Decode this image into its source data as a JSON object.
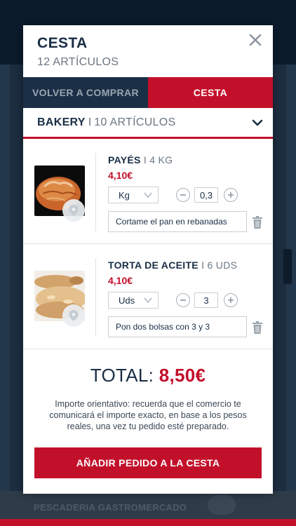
{
  "background": {
    "footer_text": "PESCADERIA GASTROMERCADO"
  },
  "cart": {
    "title": "CESTA",
    "subtitle": "12 ARTÍCULOS",
    "tabs": [
      {
        "label": "VOLVER A COMPRAR",
        "active": false
      },
      {
        "label": "CESTA",
        "active": true
      }
    ],
    "section": {
      "name": "BAKERY",
      "separator": "I",
      "count": "10 ARTÍCULOS"
    },
    "items": [
      {
        "name": "PAYÉS",
        "quantity_label": "I 4 KG",
        "price": "4,10€",
        "unit": "Kg",
        "quantity": "0,3",
        "note": "Cortame el pan en rebanadas",
        "image": "bread-loaf"
      },
      {
        "name": "TORTA DE ACEITE",
        "quantity_label": "I 6 UDS",
        "price": "4,10€",
        "unit": "Uds",
        "quantity": "3",
        "note": "Pon dos bolsas con 3 y 3",
        "image": "flatbread"
      }
    ],
    "total_label": "TOTAL:",
    "total_amount": "8,50€",
    "disclaimer": "Importe orientativo: recuerda que el comercio te comunicará el importe exacto, en base a los pesos reales, una vez tu pedido esté preparado.",
    "add_button": "AÑADIR PEDIDO A LA CESTA",
    "icons": {
      "close": "close-icon",
      "chevron": "chevron-down-icon",
      "pin": "map-pin-icon",
      "trash": "trash-icon",
      "minus": "minus-icon",
      "plus": "plus-icon"
    },
    "colors": {
      "brand_red": "#c3102a",
      "navy": "#1b2f46"
    }
  }
}
